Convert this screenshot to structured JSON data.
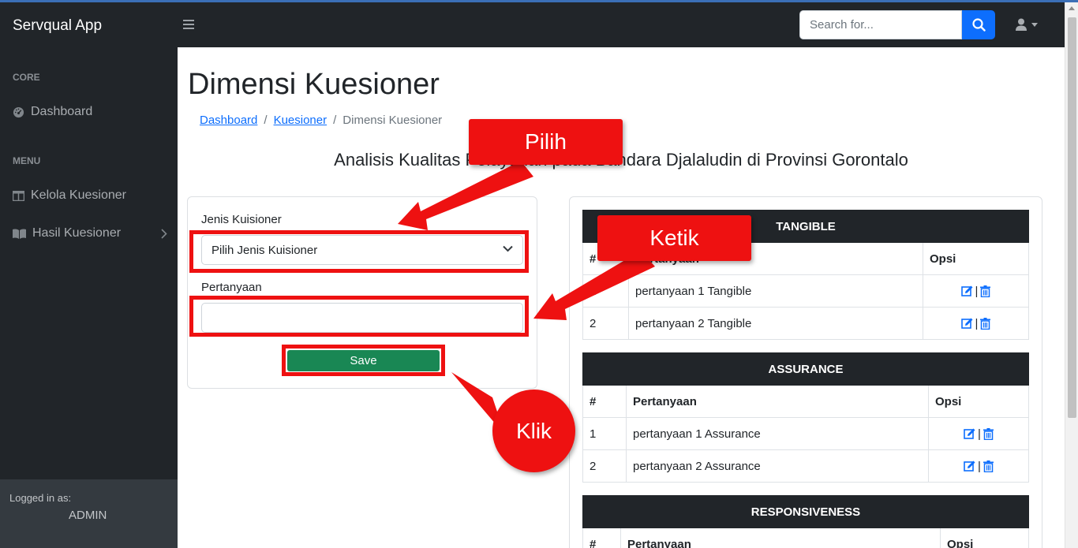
{
  "app": {
    "brand": "Servqual App"
  },
  "search": {
    "placeholder": "Search for..."
  },
  "sidebar": {
    "core_heading": "CORE",
    "menu_heading": "MENU",
    "items": [
      {
        "label": "Dashboard",
        "icon": "dashboard-icon"
      },
      {
        "label": "Kelola Kuesioner",
        "icon": "columns-icon"
      },
      {
        "label": "Hasil Kuesioner",
        "icon": "book-open-icon"
      }
    ],
    "footer": {
      "logged_in_label": "Logged in as:",
      "user": "ADMIN"
    }
  },
  "page": {
    "title": "Dimensi Kuesioner",
    "breadcrumb": [
      "Dashboard",
      "Kuesioner",
      "Dimensi Kuesioner"
    ],
    "subtitle": "Analisis Kualitas Pelayanan pada Bandara Djalaludin di Provinsi Gorontalo"
  },
  "form": {
    "jenis_label": "Jenis Kuisioner",
    "jenis_selected": "Pilih Jenis Kuisioner",
    "pertanyaan_label": "Pertanyaan",
    "pertanyaan_value": "",
    "save_label": "Save"
  },
  "tables": [
    {
      "category": "TANGIBLE",
      "headers": [
        "#",
        "Pertanyaan",
        "Opsi"
      ],
      "rows": [
        {
          "no": "1",
          "text": "pertanyaan 1 Tangible"
        },
        {
          "no": "2",
          "text": "pertanyaan 2 Tangible"
        }
      ]
    },
    {
      "category": "ASSURANCE",
      "headers": [
        "#",
        "Pertanyaan",
        "Opsi"
      ],
      "rows": [
        {
          "no": "1",
          "text": "pertanyaan 1 Assurance"
        },
        {
          "no": "2",
          "text": "pertanyaan 2 Assurance"
        }
      ]
    },
    {
      "category": "RESPONSIVENESS",
      "headers": [
        "#",
        "Pertanyaan",
        "Opsi"
      ],
      "rows": []
    }
  ],
  "opsi_separator": "|",
  "annotations": {
    "pilih": "Pilih",
    "ketik": "Ketik",
    "klik": "Klik"
  },
  "colors": {
    "annotation": "#ee1111",
    "save": "#198754",
    "primary": "#0d6efd",
    "dark": "#212529"
  }
}
